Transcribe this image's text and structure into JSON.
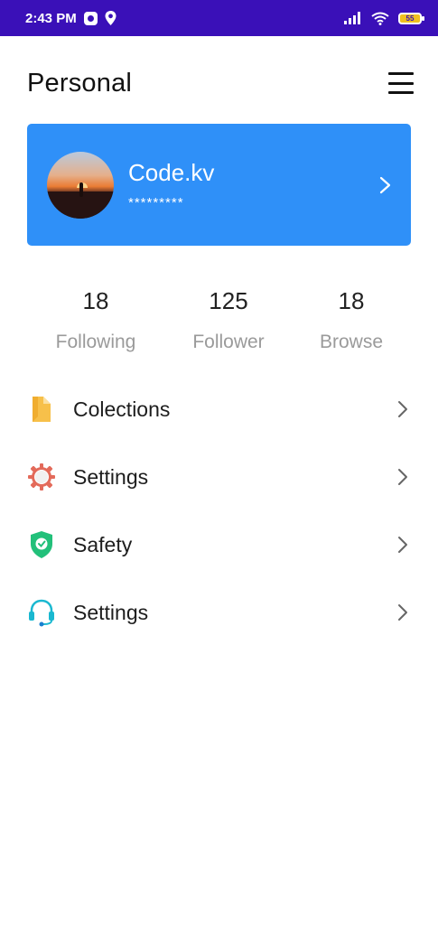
{
  "status_bar": {
    "time": "2:43 PM",
    "battery_level": "55",
    "icons": [
      "app-notification-icon",
      "location-pin-icon",
      "signal-icon",
      "wifi-icon",
      "battery-icon"
    ]
  },
  "header": {
    "title": "Personal",
    "menu_icon": "hamburger-menu-icon"
  },
  "profile": {
    "name": "Code.kv",
    "password_masked": "*********",
    "card_color": "#2f90f8"
  },
  "stats": [
    {
      "value": "18",
      "label": "Following"
    },
    {
      "value": "125",
      "label": "Follower"
    },
    {
      "value": "18",
      "label": "Browse"
    }
  ],
  "menu": [
    {
      "label": "Colections",
      "icon": "document-icon",
      "icon_color": "#f7c04a"
    },
    {
      "label": "Settings",
      "icon": "gear-icon",
      "icon_color": "#e36a5a"
    },
    {
      "label": "Safety",
      "icon": "shield-icon",
      "icon_color": "#22c07a"
    },
    {
      "label": "Settings",
      "icon": "headset-icon",
      "icon_color": "#1ab8d0"
    }
  ],
  "colors": {
    "status_bar": "#3a10b8",
    "accent": "#2f90f8",
    "muted_text": "#9a9a9a"
  }
}
